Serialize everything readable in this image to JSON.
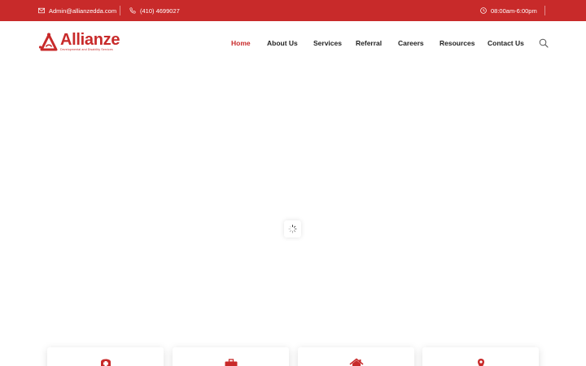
{
  "topbar": {
    "email": "Admin@allianzedda.com",
    "phone": "(410) 4699027",
    "hours": "08:00am-6:00pm"
  },
  "brand": {
    "name": "Allianze",
    "tagline": "Developmental and Disability Services",
    "color": "#c82a2a"
  },
  "nav": {
    "items": [
      "Home",
      "About Us",
      "Services",
      "Referral",
      "Careers",
      "Resources",
      "Contact Us"
    ],
    "active": "Home"
  },
  "icons": {
    "email": "envelope-icon",
    "phone": "phone-icon",
    "hours": "clock-icon",
    "search": "search-icon",
    "loader": "spinner-icon",
    "cards": [
      "nurse-cap-icon",
      "briefcase-icon",
      "home-icon",
      "location-pin-icon"
    ]
  }
}
